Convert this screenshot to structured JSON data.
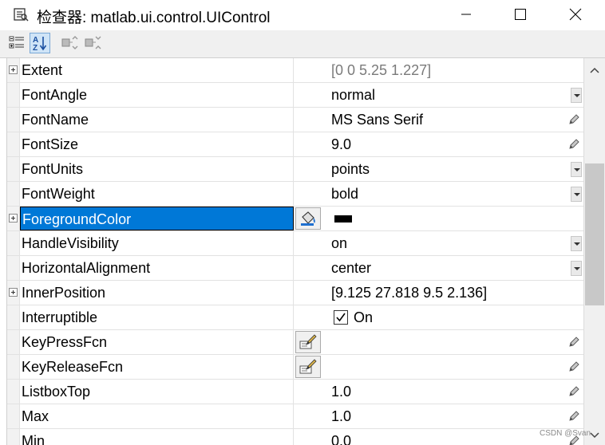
{
  "window": {
    "title": "检查器: matlab.ui.control.UIControl"
  },
  "toolbar": {
    "buttons": [
      {
        "name": "categorized-view-button",
        "active": false
      },
      {
        "name": "sort-alphabetical-button",
        "active": true
      },
      {
        "name": "expand-all-button",
        "active": false
      },
      {
        "name": "collapse-all-button",
        "active": false
      }
    ]
  },
  "properties": [
    {
      "name": "Extent",
      "value": "[0 0 5.25 1.227]",
      "expandable": true,
      "editor": "none",
      "readonly": true
    },
    {
      "name": "FontAngle",
      "value": "normal",
      "editor": "dropdown"
    },
    {
      "name": "FontName",
      "value": "MS Sans Serif",
      "editor": "pencil"
    },
    {
      "name": "FontSize",
      "value": "9.0",
      "editor": "pencil"
    },
    {
      "name": "FontUnits",
      "value": "points",
      "editor": "dropdown"
    },
    {
      "name": "FontWeight",
      "value": "bold",
      "editor": "dropdown"
    },
    {
      "name": "ForegroundColor",
      "value": "",
      "expandable": true,
      "editor": "color",
      "selected": true,
      "swatch": "#000000"
    },
    {
      "name": "HandleVisibility",
      "value": "on",
      "editor": "dropdown"
    },
    {
      "name": "HorizontalAlignment",
      "value": "center",
      "editor": "dropdown"
    },
    {
      "name": "InnerPosition",
      "value": "[9.125 27.818 9.5 2.136]",
      "expandable": true,
      "editor": "none"
    },
    {
      "name": "Interruptible",
      "value": "On",
      "editor": "checkbox",
      "checked": true
    },
    {
      "name": "KeyPressFcn",
      "value": "",
      "editor": "callback"
    },
    {
      "name": "KeyReleaseFcn",
      "value": "",
      "editor": "callback"
    },
    {
      "name": "ListboxTop",
      "value": "1.0",
      "editor": "pencil"
    },
    {
      "name": "Max",
      "value": "1.0",
      "editor": "pencil"
    },
    {
      "name": "Min",
      "value": "0.0",
      "editor": "pencil"
    }
  ],
  "colors": {
    "selection": "#0078d7",
    "toolbar_bg": "#f0f0f0"
  },
  "watermark": "CSDN @Svan"
}
